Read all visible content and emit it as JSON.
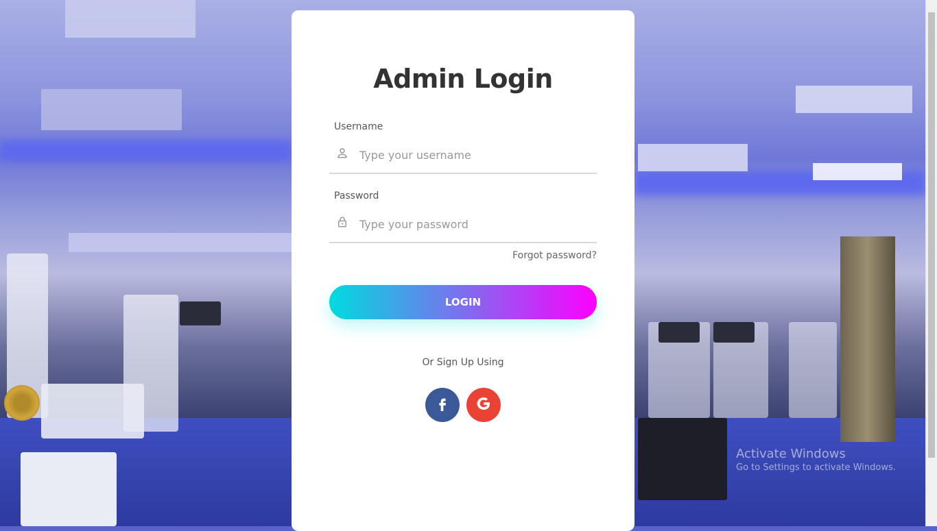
{
  "page": {
    "title": "Admin Login"
  },
  "form": {
    "username": {
      "label": "Username",
      "placeholder": "Type your username",
      "icon": "person-icon"
    },
    "password": {
      "label": "Password",
      "placeholder": "Type your password",
      "icon": "lock-icon"
    },
    "forgot_label": "Forgot password?",
    "login_label": "LOGIN",
    "alt_signup_label": "Or Sign Up Using"
  },
  "social": [
    {
      "name": "facebook",
      "icon": "facebook-icon",
      "color": "#3b5998"
    },
    {
      "name": "google",
      "icon": "google-icon",
      "color": "#ea4335"
    }
  ],
  "colors": {
    "gradient_start": "#00dbde",
    "gradient_end": "#fc00ff"
  },
  "watermark": {
    "line1": "Activate Windows",
    "line2": "Go to Settings to activate Windows."
  }
}
